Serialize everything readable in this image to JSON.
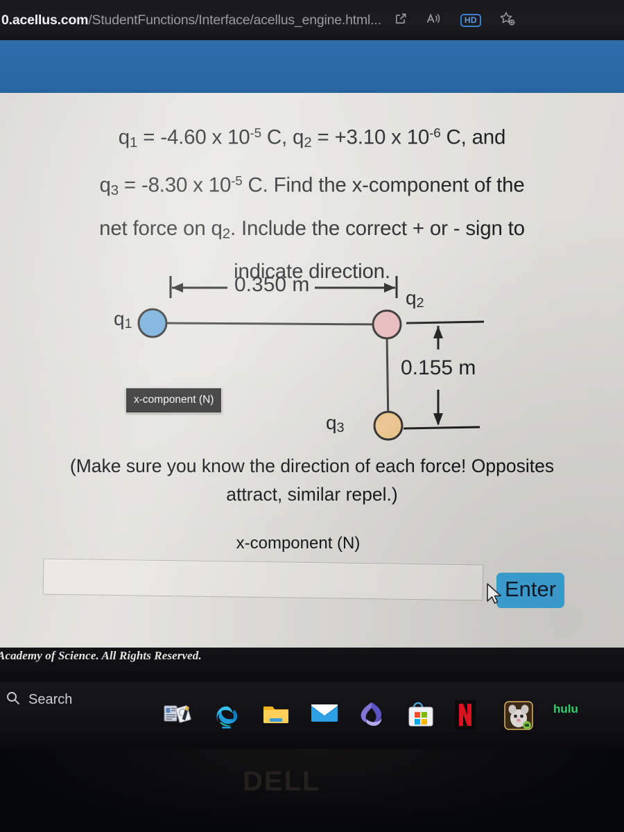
{
  "browser": {
    "url_domain": "0.acellus.com",
    "url_path": "/StudentFunctions/Interface/acellus_engine.html",
    "url_ellipsis": "...",
    "icons": {
      "open_external": "open-in-new-tab-icon",
      "read_aloud": "read-aloud-icon",
      "hd_badge": "HD",
      "add_favorite": "add-to-favorites-icon"
    }
  },
  "question": {
    "line1_a": "q",
    "line1_sub1": "1",
    "line1_b": " = -4.60 x 10",
    "line1_exp1": "-5",
    "line1_c": " C, q",
    "line1_sub2": "2",
    "line1_d": " = +3.10 x 10",
    "line1_exp2": "-6",
    "line1_e": " C, and",
    "line2_a": "q",
    "line2_sub3": "3",
    "line2_b": " = -8.30 x 10",
    "line2_exp3": "-5",
    "line2_c": " C. Find the x-component of the",
    "line3": "net force on q",
    "line3_sub": "2",
    "line3_b": ". Include the correct + or - sign to",
    "line4": "indicate direction."
  },
  "diagram": {
    "label_q1": "q",
    "label_q1_sub": "1",
    "label_q2": "q",
    "label_q2_sub": "2",
    "label_q3": "q",
    "label_q3_sub": "3",
    "horizontal_distance": "0.350 m",
    "vertical_distance": "0.155 m",
    "colors": {
      "q1": "#6aa9d8",
      "q2": "#e9b9bb",
      "q3": "#f2ca8e",
      "outline": "#2b2b2b"
    }
  },
  "tooltip": {
    "text": "x-component (N)"
  },
  "note": {
    "line1": "(Make sure you know the direction of each force! Opposites",
    "line2": "attract, similar repel.)"
  },
  "answer": {
    "label": "x-component (N)",
    "value": "",
    "placeholder": "",
    "enter_label": "Enter",
    "enter_color": "#3fa8dc"
  },
  "footer": {
    "text": "Academy of Science.  All Rights Reserved."
  },
  "taskbar": {
    "search_label": "Search",
    "search_icon": "search-icon",
    "items": [
      {
        "name": "widgets-icon",
        "label": "Widgets"
      },
      {
        "name": "edge-icon",
        "label": "Microsoft Edge"
      },
      {
        "name": "file-explorer-icon",
        "label": "File Explorer"
      },
      {
        "name": "mail-icon",
        "label": "Mail"
      },
      {
        "name": "microsoft-365-icon",
        "label": "Microsoft 365"
      },
      {
        "name": "microsoft-store-icon",
        "label": "Microsoft Store"
      },
      {
        "name": "netflix-icon",
        "label": "N"
      },
      {
        "name": "game-app-icon",
        "label": "Game"
      },
      {
        "name": "hulu-icon",
        "label": "hulu"
      }
    ]
  },
  "device": {
    "brand": "DELL"
  }
}
